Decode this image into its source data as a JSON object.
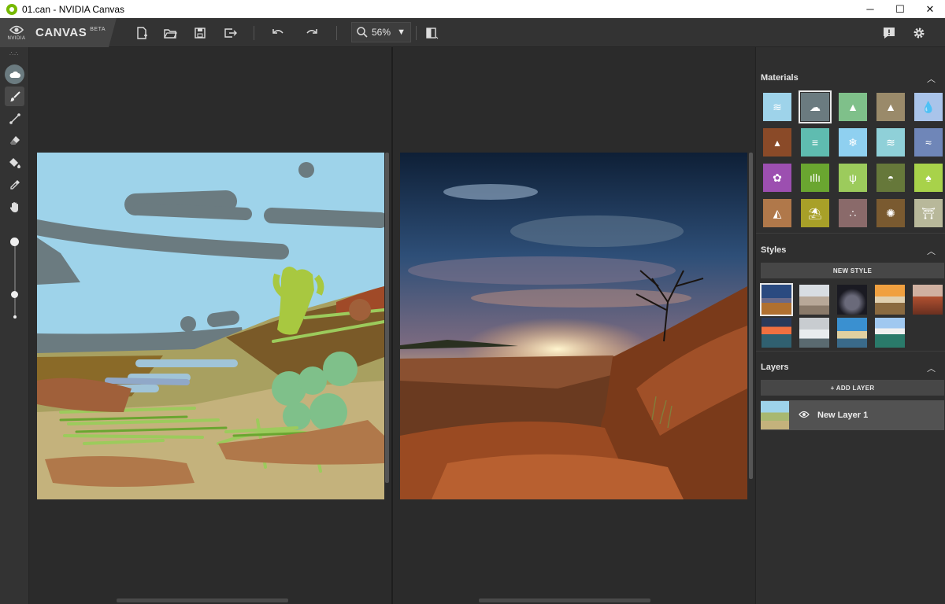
{
  "window": {
    "title": "01.can - NVIDIA Canvas",
    "minimize": "─",
    "maximize": "☐",
    "close": "✕"
  },
  "brand": {
    "logo_text": "NVIDIA",
    "name": "CANVAS",
    "badge": "BETA"
  },
  "toolbar": {
    "zoom_value": "56%",
    "zoom_arrow": "▼",
    "icons": [
      "new-file-icon",
      "open-folder-icon",
      "save-icon",
      "export-icon",
      "undo-icon",
      "redo-icon",
      "zoom-icon",
      "split-view-icon",
      "feedback-icon",
      "settings-icon"
    ]
  },
  "tools": [
    "material-brush-icon",
    "brush-icon",
    "line-icon",
    "eraser-icon",
    "fill-icon",
    "eyedropper-icon",
    "pan-hand-icon"
  ],
  "brush_size_level": 0.3,
  "panel": {
    "materials_title": "Materials",
    "styles_title": "Styles",
    "layers_title": "Layers",
    "collapse_chevron": "︿",
    "new_style_label": "NEW STYLE",
    "add_layer_label": "+ ADD LAYER",
    "layer_name": "New Layer 1",
    "materials": [
      {
        "color": "#9ed3ea",
        "icon": "sea-icon",
        "glyph": "≋"
      },
      {
        "color": "#6b7b80",
        "icon": "cloud-icon",
        "glyph": "☁",
        "selected": true
      },
      {
        "color": "#7fc08a",
        "icon": "hill-icon",
        "glyph": "▲"
      },
      {
        "color": "#9a8a6a",
        "icon": "mountain-icon",
        "glyph": "▲"
      },
      {
        "color": "#a9c4ea",
        "icon": "water-drop-icon",
        "glyph": "💧"
      },
      {
        "color": "#8a4a28",
        "icon": "dirt-icon",
        "glyph": "▴"
      },
      {
        "color": "#5fbcb0",
        "icon": "fog-icon",
        "glyph": "≡"
      },
      {
        "color": "#8fd0f0",
        "icon": "snow-icon",
        "glyph": "❄"
      },
      {
        "color": "#8fd0d8",
        "icon": "lake-icon",
        "glyph": "≋"
      },
      {
        "color": "#6f86b8",
        "icon": "water-icon",
        "glyph": "≈"
      },
      {
        "color": "#9c4fb0",
        "icon": "flower-icon",
        "glyph": "✿"
      },
      {
        "color": "#6aa630",
        "icon": "grass-icon",
        "glyph": "ıllı"
      },
      {
        "color": "#9ccb5c",
        "icon": "plant-icon",
        "glyph": "ψ"
      },
      {
        "color": "#66783a",
        "icon": "bush-icon",
        "glyph": "◓"
      },
      {
        "color": "#a8d24a",
        "icon": "tree-icon",
        "glyph": "♠"
      },
      {
        "color": "#b0784a",
        "icon": "rock-icon",
        "glyph": "◭"
      },
      {
        "color": "#a8a028",
        "icon": "beach-icon",
        "glyph": "⛱"
      },
      {
        "color": "#8a6a6a",
        "icon": "gravel-icon",
        "glyph": "∴"
      },
      {
        "color": "#7a5a30",
        "icon": "sand-icon",
        "glyph": "✺"
      },
      {
        "color": "#b8b89a",
        "icon": "building-icon",
        "glyph": "⛩"
      }
    ]
  }
}
